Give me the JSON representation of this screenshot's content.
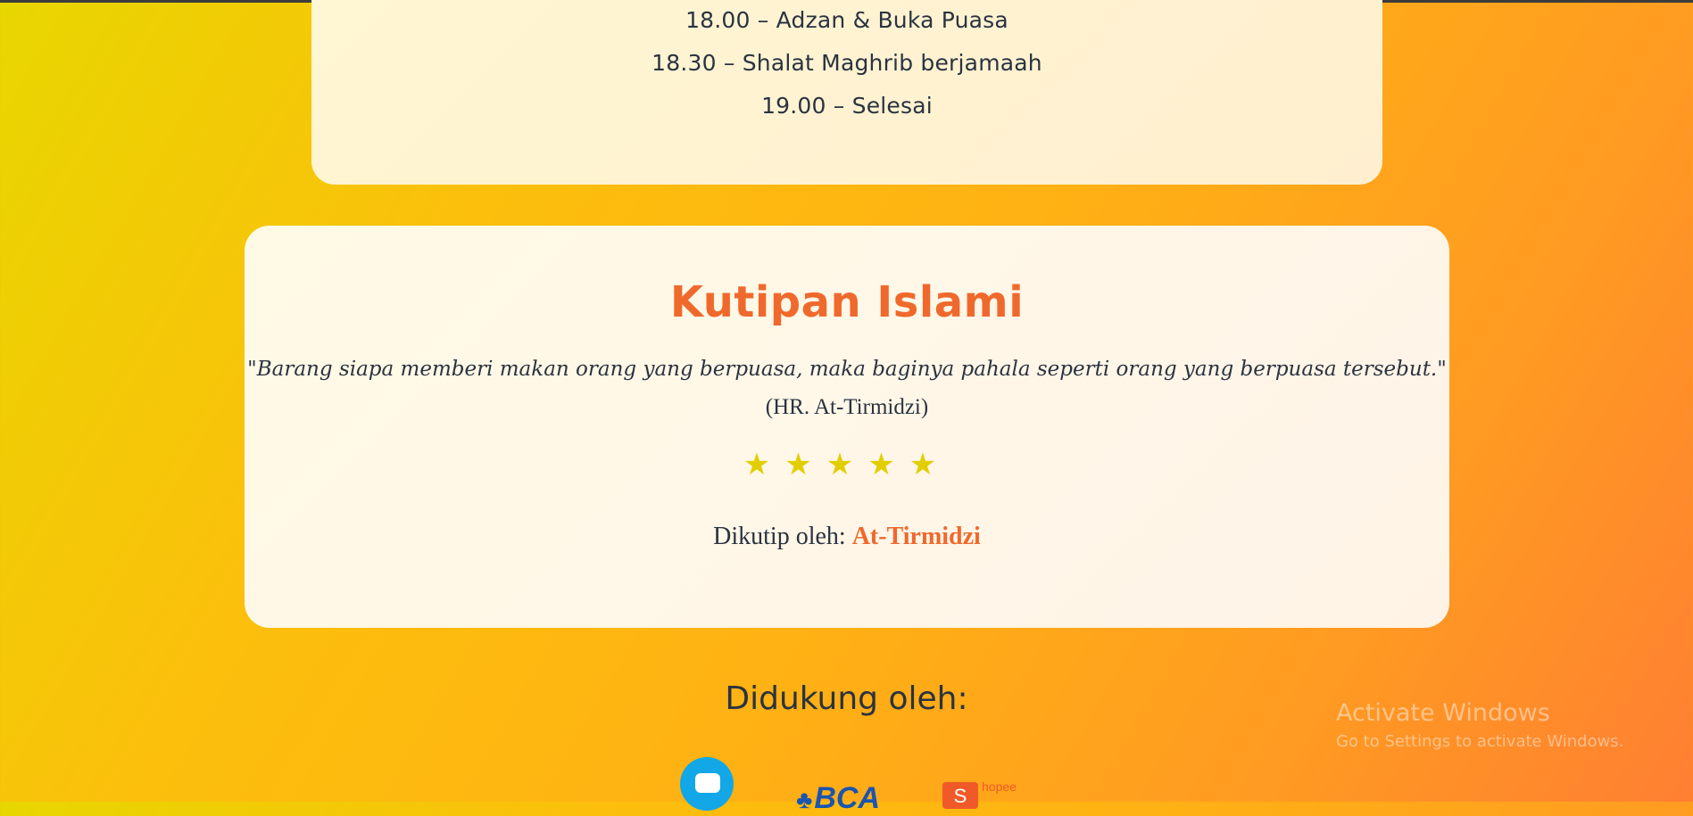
{
  "schedule": {
    "items": [
      "18.00 – Adzan & Buka Puasa",
      "18.30 – Shalat Maghrib berjamaah",
      "19.00 – Selesai"
    ]
  },
  "quote": {
    "title": "Kutipan Islami",
    "text": "\"Barang siapa memberi makan orang yang berpuasa, maka baginya pahala seperti orang yang berpuasa tersebut.\"",
    "source": "(HR. At-Tirmidzi)",
    "stars": "★★★★★",
    "rating": 5,
    "quoted_by_label": "Dikutip oleh: ",
    "quoted_by_author": "At-Tirmidzi"
  },
  "supporters": {
    "heading": "Didukung oleh:",
    "logos": [
      "wallet-logo",
      "BCA",
      "ShopeePay"
    ],
    "bca_text": "BCA",
    "shopee_mark": "S",
    "shopee_text": "hopee"
  },
  "watermark": {
    "title": "Activate Windows",
    "subtitle": "Go to Settings to activate Windows."
  },
  "colors": {
    "accent": "#f0692c",
    "text": "#2a3340",
    "star": "#e2ce00"
  }
}
